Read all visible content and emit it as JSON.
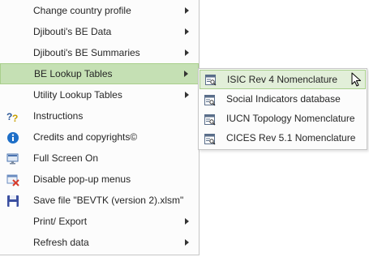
{
  "main_menu": {
    "items": [
      {
        "label": "Change country profile",
        "has_submenu": true,
        "icon": ""
      },
      {
        "label": "Djibouti's BE Data",
        "has_submenu": true,
        "icon": ""
      },
      {
        "label": "Djibouti's BE Summaries",
        "has_submenu": true,
        "icon": ""
      },
      {
        "label": "BE Lookup Tables",
        "has_submenu": true,
        "icon": "",
        "active": true
      },
      {
        "label": "Utility Lookup Tables",
        "has_submenu": true,
        "icon": ""
      },
      {
        "label": "Instructions",
        "has_submenu": false,
        "icon": "help-icon"
      },
      {
        "label": "Credits and copyrights©",
        "has_submenu": false,
        "icon": "info-icon"
      },
      {
        "label": "Full Screen On",
        "has_submenu": false,
        "icon": "full-screen-icon"
      },
      {
        "label": "Disable pop-up menus",
        "has_submenu": false,
        "icon": "disable-menu-icon"
      },
      {
        "label": "Save file \"BEVTK (version 2).xlsm\"",
        "has_submenu": false,
        "icon": "save-icon"
      },
      {
        "label": "Print/ Export",
        "has_submenu": true,
        "icon": ""
      },
      {
        "label": "Refresh data",
        "has_submenu": true,
        "icon": ""
      }
    ]
  },
  "submenu": {
    "items": [
      {
        "label": "ISIC Rev 4 Nomenclature",
        "icon": "table-lookup-icon",
        "hover": true
      },
      {
        "label": "Social Indicators database",
        "icon": "table-lookup-icon"
      },
      {
        "label": "IUCN Topology Nomenclature",
        "icon": "table-lookup-icon"
      },
      {
        "label": "CICES Rev 5.1 Nomenclature",
        "icon": "table-lookup-icon"
      }
    ]
  },
  "colors": {
    "active_bg": "#c5e0b4",
    "hover_bg": "#e2efd9",
    "border": "#a9cf8c"
  }
}
